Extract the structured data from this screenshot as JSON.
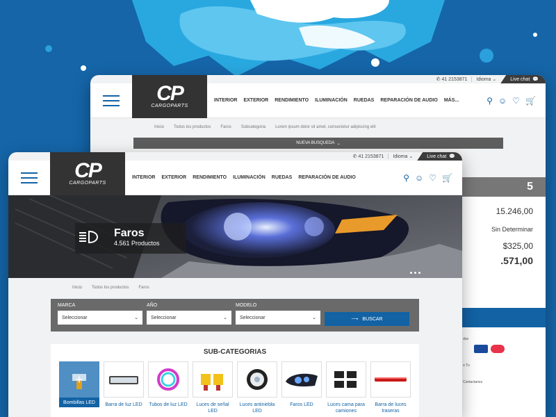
{
  "colors": {
    "brand_blue": "#1262a4",
    "dark": "#333333",
    "gray_bar": "#6a6a6a"
  },
  "back_window": {
    "topbar": {
      "phone": "41 2153871",
      "language": "Idioma",
      "live_chat": "Live chat"
    },
    "logo": {
      "mark": "CP",
      "brand": "CARGOPARTS"
    },
    "nav": [
      "INTERIOR",
      "EXTERIOR",
      "RENDIMIENTO",
      "ILUMINACIÓN",
      "RUEDAS",
      "REPARACIÓN DE AUDIO",
      "MÁS..."
    ],
    "breadcrumb": [
      "Inicio",
      "Todos los productos",
      "Faros",
      "Subcategoria",
      "Lorem ipsum dolor sit amet, consectetur adipiscing elit"
    ],
    "new_search": "NUEVA BUSQUEDA",
    "side": {
      "count": "5",
      "price1": "15.246,00",
      "note": "Sin Determinar",
      "price2": "$325,00",
      "price3": ".571,00"
    },
    "footer_bits": {
      "payments": "dos",
      "contact": "Contactanos",
      "tu": "o Tu"
    }
  },
  "front_window": {
    "topbar": {
      "phone": "41 2153871",
      "language": "Idioma",
      "live_chat": "Live chat"
    },
    "logo": {
      "mark": "CP",
      "brand": "CARGOPARTS"
    },
    "nav": [
      "INTERIOR",
      "EXTERIOR",
      "RENDIMIENTO",
      "ILUMINACIÓN",
      "RUEDAS",
      "REPARACIÓN DE AUDIO"
    ],
    "hero": {
      "title": "Faros",
      "subtitle": "4.561 Productos"
    },
    "breadcrumb": [
      "Inicio",
      "Todos los productos",
      "Faros"
    ],
    "filters": [
      {
        "label": "MARCA",
        "value": "Seleccionar"
      },
      {
        "label": "AÑO",
        "value": "Seleccionar"
      },
      {
        "label": "MODELO",
        "value": "Seleccionar"
      }
    ],
    "search_button": "BUSCAR",
    "subcategories_title": "SUB-CATEGORIAS",
    "subcategories": [
      {
        "label": "Bombillas LED",
        "icon": "bulb-icon"
      },
      {
        "label": "Barra de luz LED",
        "icon": "lightbar-icon"
      },
      {
        "label": "Tubos de luz LED",
        "icon": "tube-icon"
      },
      {
        "label": "Luces de señal LED",
        "icon": "signal-bulb-icon"
      },
      {
        "label": "Luces antiniebla LED",
        "icon": "foglight-icon"
      },
      {
        "label": "Faros LED",
        "icon": "headlight-icon"
      },
      {
        "label": "Luces cama para camiones",
        "icon": "bedlight-icon"
      },
      {
        "label": "Barra de luces traseras",
        "icon": "tailbar-icon"
      }
    ]
  }
}
